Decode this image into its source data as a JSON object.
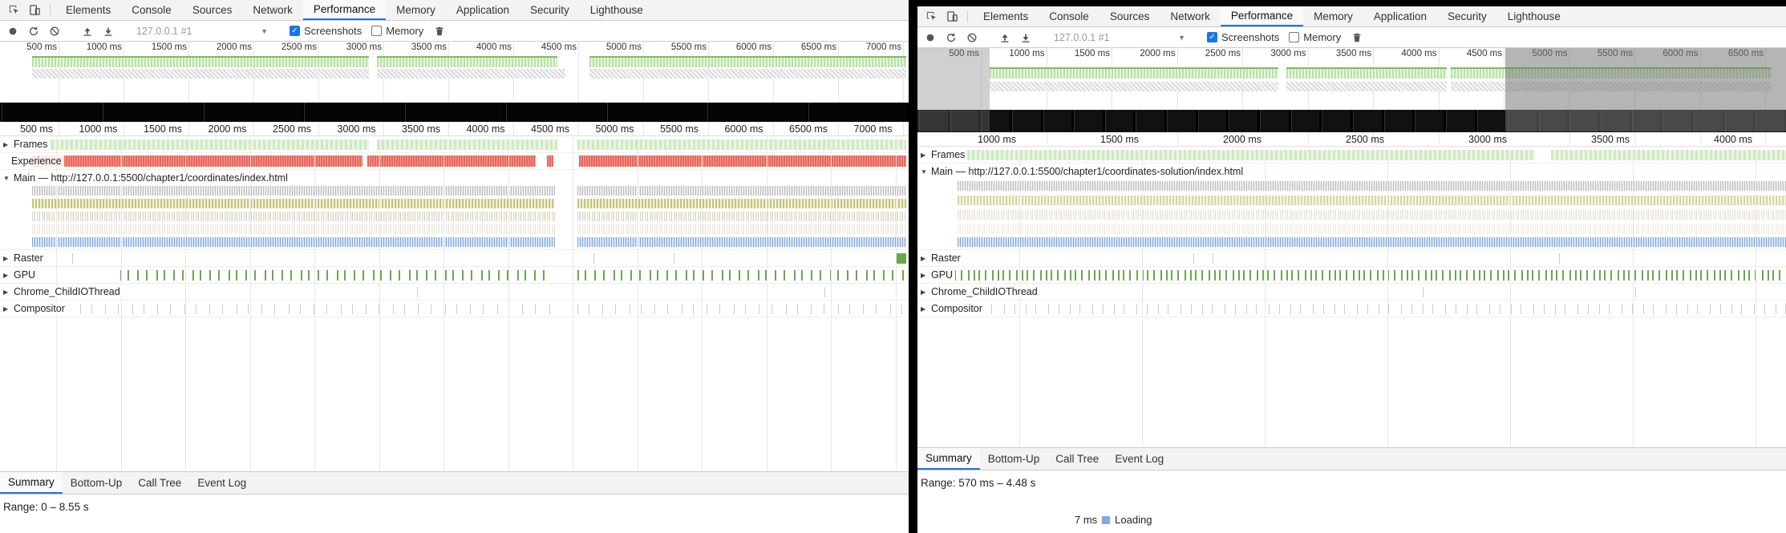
{
  "left": {
    "tabs": [
      "Elements",
      "Console",
      "Sources",
      "Network",
      "Performance",
      "Memory",
      "Application",
      "Security",
      "Lighthouse"
    ],
    "active_tab": "Performance",
    "toolbar": {
      "target": "127.0.0.1 #1",
      "screenshots_label": "Screenshots",
      "screenshots_checked": true,
      "memory_label": "Memory",
      "memory_checked": false
    },
    "overview_ticks": [
      "500 ms",
      "1000 ms",
      "1500 ms",
      "2000 ms",
      "2500 ms",
      "3000 ms",
      "3500 ms",
      "4000 ms",
      "4500 ms",
      "5000 ms",
      "5500 ms",
      "6000 ms",
      "6500 ms",
      "7000 ms"
    ],
    "ruler_ticks": [
      "500 ms",
      "1000 ms",
      "1500 ms",
      "2000 ms",
      "2500 ms",
      "3000 ms",
      "3500 ms",
      "4000 ms",
      "4500 ms",
      "5000 ms",
      "5500 ms",
      "6000 ms",
      "6500 ms",
      "7000 ms"
    ],
    "tracks": {
      "frames": "Frames",
      "experience": "Experience",
      "main": "Main — http://127.0.0.1:5500/chapter1/coordinates/index.html",
      "raster": "Raster",
      "gpu": "GPU",
      "io": "Chrome_ChildIOThread",
      "compositor": "Compositor"
    },
    "bottom_tabs": [
      "Summary",
      "Bottom-Up",
      "Call Tree",
      "Event Log"
    ],
    "active_bottom_tab": "Summary",
    "range": "Range: 0 – 8.55 s"
  },
  "right": {
    "tabs": [
      "Elements",
      "Console",
      "Sources",
      "Network",
      "Performance",
      "Memory",
      "Application",
      "Security",
      "Lighthouse"
    ],
    "active_tab": "Performance",
    "toolbar": {
      "target": "127.0.0.1 #1",
      "screenshots_label": "Screenshots",
      "screenshots_checked": true,
      "memory_label": "Memory",
      "memory_checked": false
    },
    "overview_ticks": [
      "500 ms",
      "1000 ms",
      "1500 ms",
      "2000 ms",
      "2500 ms",
      "3000 ms",
      "3500 ms",
      "4000 ms",
      "4500 ms",
      "5000 ms",
      "5500 ms",
      "6000 ms",
      "6500 ms"
    ],
    "ruler_ticks": [
      "1000 ms",
      "1500 ms",
      "2000 ms",
      "2500 ms",
      "3000 ms",
      "3500 ms",
      "4000 ms"
    ],
    "tracks": {
      "frames": "Frames",
      "main": "Main — http://127.0.0.1:5500/chapter1/coordinates-solution/index.html",
      "raster": "Raster",
      "gpu": "GPU",
      "io": "Chrome_ChildIOThread",
      "compositor": "Compositor"
    },
    "bottom_tabs": [
      "Summary",
      "Bottom-Up",
      "Call Tree",
      "Event Log"
    ],
    "active_bottom_tab": "Summary",
    "range": "Range: 570 ms – 4.48 s",
    "legend": {
      "value": "7 ms",
      "label": "Loading",
      "color": "#82a9e0"
    }
  },
  "colors": {
    "accent": "#1a73e8",
    "frames": "#79c05a",
    "experience": "#e8675b",
    "gpu": "#6aa84f"
  }
}
